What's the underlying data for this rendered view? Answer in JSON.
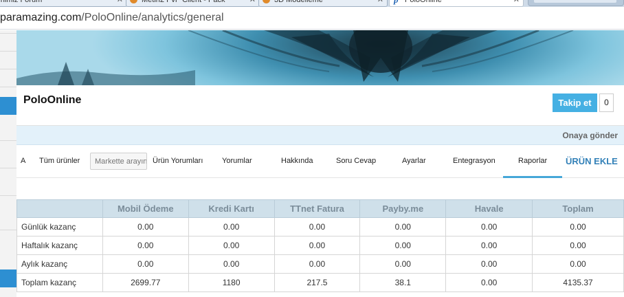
{
  "browser": {
    "tabs": [
      {
        "label": "Tarihimiz Forum"
      },
      {
        "label": "Metin2 PvP Client - Pack"
      },
      {
        "label": "3D Modelleme"
      },
      {
        "label": "PoloOnline",
        "active": true
      }
    ],
    "url_host": "paramazing.com",
    "url_path": "/PoloOnline/analytics/general"
  },
  "store": {
    "name": "PoloOnline",
    "follow_label": "Takip et",
    "follow_count": "0",
    "approval_label": "Onaya gönder"
  },
  "nav": {
    "item_a": "A",
    "all_products": "Tüm ürünler",
    "search_placeholder": "Markette arayın",
    "product_reviews": "Ürün Yorumları",
    "reviews": "Yorumlar",
    "about": "Hakkında",
    "qa": "Soru Cevap",
    "settings": "Ayarlar",
    "integration": "Entegrasyon",
    "reports": "Raporlar",
    "add_product": "ÜRÜN EKLE"
  },
  "report": {
    "columns": [
      "",
      "Mobil Ödeme",
      "Kredi Kartı",
      "TTnet Fatura",
      "Payby.me",
      "Havale",
      "Toplam"
    ],
    "rows": [
      {
        "label": "Günlük kazanç",
        "values": [
          "0.00",
          "0.00",
          "0.00",
          "0.00",
          "0.00",
          "0.00"
        ]
      },
      {
        "label": "Haftalık kazanç",
        "values": [
          "0.00",
          "0.00",
          "0.00",
          "0.00",
          "0.00",
          "0.00"
        ]
      },
      {
        "label": "Aylık kazanç",
        "values": [
          "0.00",
          "0.00",
          "0.00",
          "0.00",
          "0.00",
          "0.00"
        ]
      },
      {
        "label": "Toplam kazanç",
        "values": [
          "2699.77",
          "1180",
          "217.5",
          "38.1",
          "0.00",
          "4135.37"
        ]
      }
    ]
  },
  "colors": {
    "accent": "#45b0e3",
    "link": "#3381b8",
    "table_header_bg": "#cfe0ea",
    "approval_bar_bg": "#e3f1fa"
  }
}
